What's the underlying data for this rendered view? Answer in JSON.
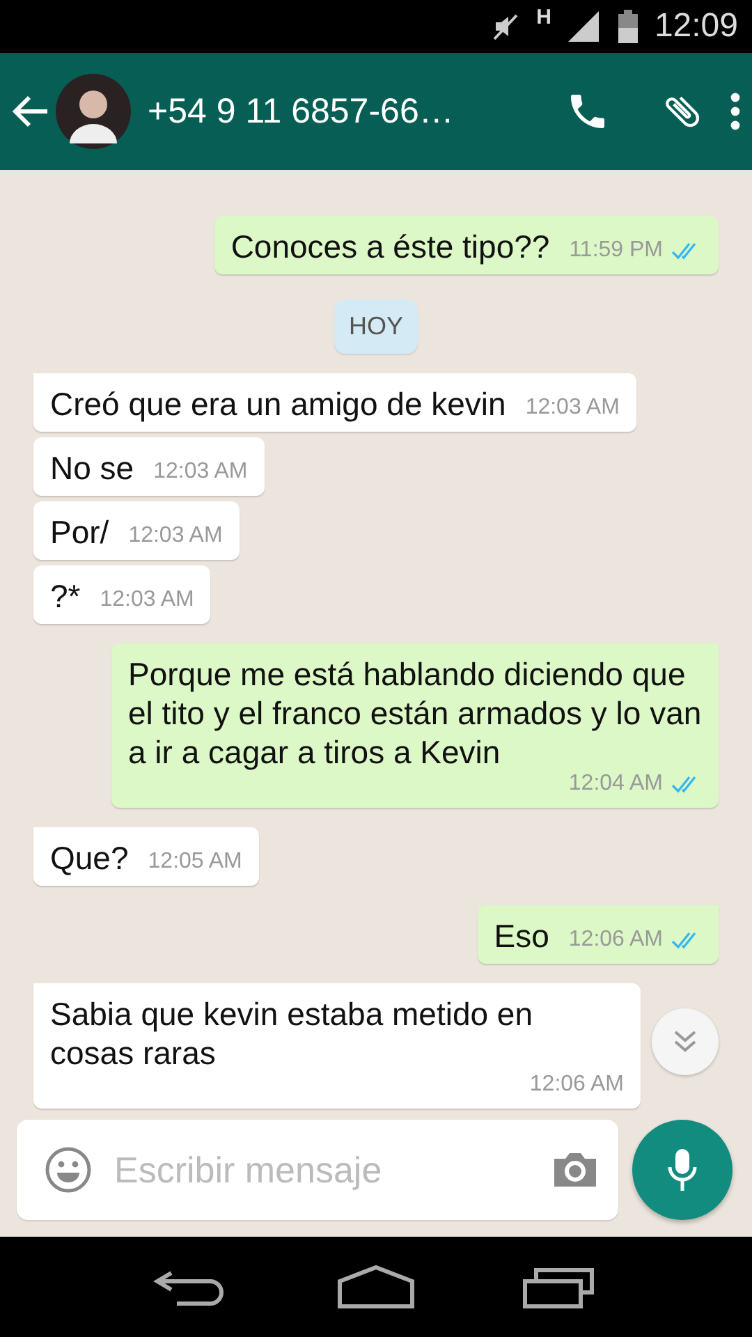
{
  "status_bar": {
    "network": "H",
    "time": "12:09"
  },
  "header": {
    "title": "+54 9 11 6857-66…"
  },
  "messages": [
    {
      "kind": "out",
      "text": "Conoces a éste tipo??",
      "time": "11:59 PM",
      "read": true,
      "tail": false
    },
    {
      "kind": "date",
      "text": "HOY"
    },
    {
      "kind": "in",
      "text": "Creó que era un amigo de kevin",
      "time": "12:03 AM",
      "tail": true
    },
    {
      "kind": "in",
      "text": "No se",
      "time": "12:03 AM",
      "tail": false
    },
    {
      "kind": "in",
      "text": "Por/",
      "time": "12:03 AM",
      "tail": false
    },
    {
      "kind": "in",
      "text": "?*",
      "time": "12:03 AM",
      "tail": false
    },
    {
      "kind": "out",
      "text": "Porque me está hablando diciendo que el tito y el franco están armados y lo van a ir a cagar a tiros a Kevin",
      "time": "12:04 AM",
      "read": true,
      "tail": true
    },
    {
      "kind": "in",
      "text": "Que?",
      "time": "12:05 AM",
      "tail": true
    },
    {
      "kind": "out",
      "text": "Eso",
      "time": "12:06 AM",
      "read": true,
      "tail": true
    },
    {
      "kind": "in",
      "text": "Sabia que kevin estaba metido en cosas raras",
      "time": "12:06 AM",
      "tail": true
    }
  ],
  "composer": {
    "placeholder": "Escribir mensaje"
  }
}
